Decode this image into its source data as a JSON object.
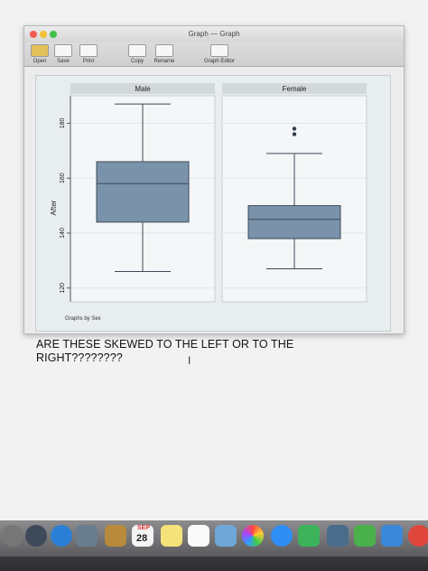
{
  "window": {
    "title": "Graph — Graph",
    "toolbar": {
      "open": "Open",
      "save": "Save",
      "print": "Print",
      "copy": "Copy",
      "rename": "Rename",
      "graph_editor": "Graph Editor"
    }
  },
  "chart_data": {
    "type": "box",
    "ylabel": "After",
    "note": "Graphs by Sex",
    "yticks": [
      120,
      140,
      160,
      180
    ],
    "ylim": [
      115,
      190
    ],
    "grid": true,
    "panels": [
      {
        "name": "Male",
        "whisker_low": 126,
        "q1": 144,
        "median": 158,
        "q3": 166,
        "whisker_high": 187,
        "outliers": []
      },
      {
        "name": "Female",
        "whisker_low": 127,
        "q1": 138,
        "median": 145,
        "q3": 150,
        "whisker_high": 169,
        "outliers": [
          176,
          178
        ]
      }
    ],
    "colors": {
      "box_fill": "#7a93ab",
      "box_stroke": "#3c4a57",
      "panel_bg": "#f4f6f7",
      "header_bg": "#d2d8dc"
    }
  },
  "question": "ARE THESE SKEWED TO THE LEFT OR TO THE RIGHT????????",
  "dock": {
    "calendar_month": "SEP",
    "calendar_day": "28"
  }
}
